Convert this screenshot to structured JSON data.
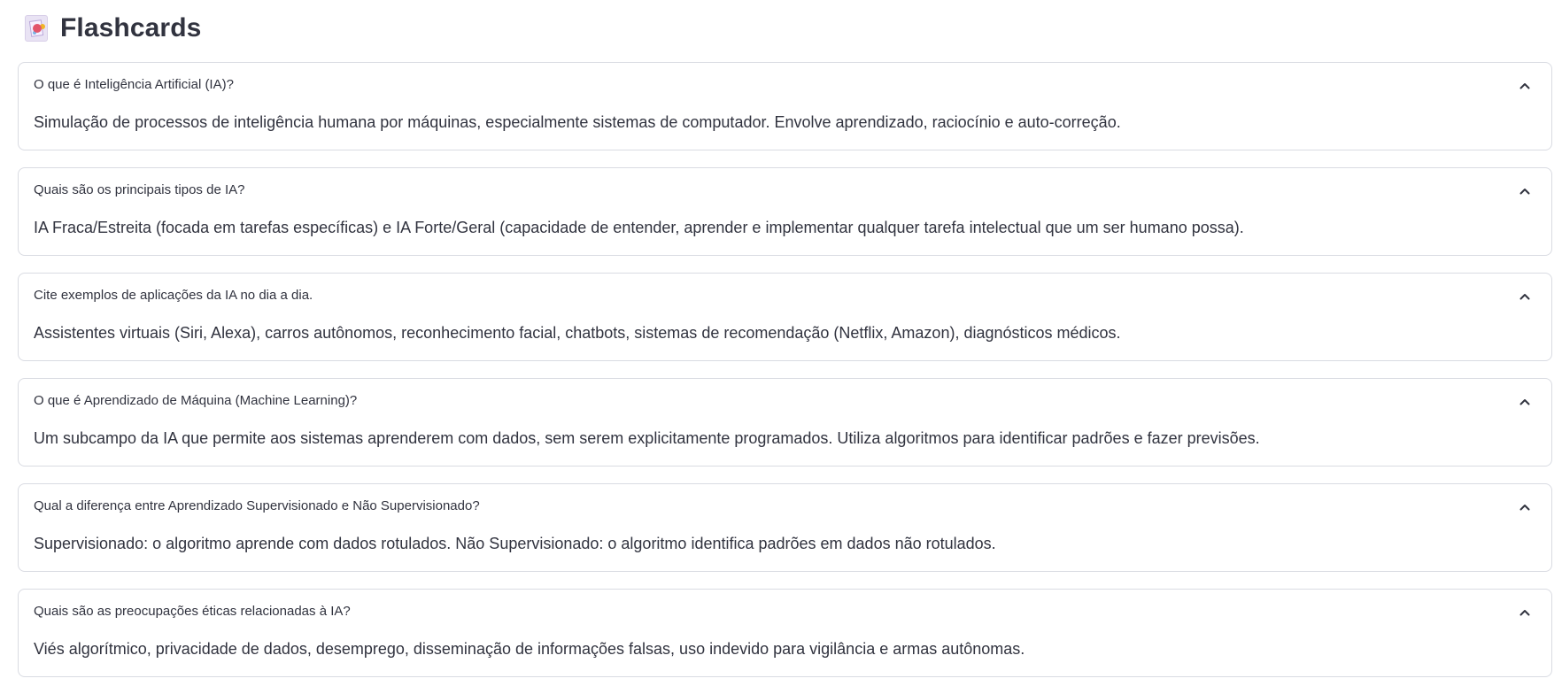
{
  "page": {
    "title": "Flashcards",
    "logo_icon": "flashcards-logo-icon"
  },
  "flashcards": [
    {
      "question": "O que é Inteligência Artificial (IA)?",
      "answer": "Simulação de processos de inteligência humana por máquinas, especialmente sistemas de computador. Envolve aprendizado, raciocínio e auto-correção.",
      "state_icon": "chevron-up-icon"
    },
    {
      "question": "Quais são os principais tipos de IA?",
      "answer": "IA Fraca/Estreita (focada em tarefas específicas) e IA Forte/Geral (capacidade de entender, aprender e implementar qualquer tarefa intelectual que um ser humano possa).",
      "state_icon": "chevron-up-icon"
    },
    {
      "question": "Cite exemplos de aplicações da IA no dia a dia.",
      "answer": "Assistentes virtuais (Siri, Alexa), carros autônomos, reconhecimento facial, chatbots, sistemas de recomendação (Netflix, Amazon), diagnósticos médicos.",
      "state_icon": "chevron-up-icon"
    },
    {
      "question": "O que é Aprendizado de Máquina (Machine Learning)?",
      "answer": "Um subcampo da IA que permite aos sistemas aprenderem com dados, sem serem explicitamente programados. Utiliza algoritmos para identificar padrões e fazer previsões.",
      "state_icon": "chevron-up-icon"
    },
    {
      "question": "Qual a diferença entre Aprendizado Supervisionado e Não Supervisionado?",
      "answer": "Supervisionado: o algoritmo aprende com dados rotulados. Não Supervisionado: o algoritmo identifica padrões em dados não rotulados.",
      "state_icon": "chevron-up-icon"
    },
    {
      "question": "Quais são as preocupações éticas relacionadas à IA?",
      "answer": "Viés algorítmico, privacidade de dados, desemprego, disseminação de informações falsas, uso indevido para vigilância e armas autônomas.",
      "state_icon": "chevron-up-icon"
    }
  ],
  "colors": {
    "text": "#31333f",
    "border": "#d9dbe2",
    "background": "#ffffff"
  }
}
